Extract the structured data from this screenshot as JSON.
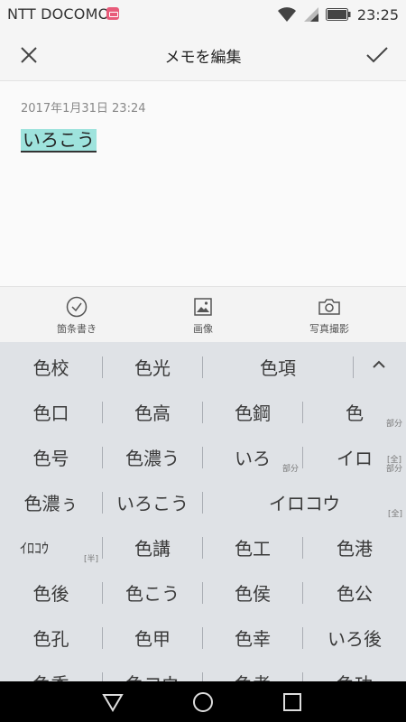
{
  "status_bar": {
    "carrier": "NTT DOCOMO",
    "time": "23:25"
  },
  "app_bar": {
    "title": "メモを編集"
  },
  "note": {
    "date": "2017年1月31日 23:24",
    "text": "いろこう"
  },
  "toolbar": {
    "items": [
      {
        "label": "箇条書き"
      },
      {
        "label": "画像"
      },
      {
        "label": "写真撮影"
      }
    ]
  },
  "candidates": {
    "rows": [
      [
        {
          "text": "色校"
        },
        {
          "text": "色光"
        },
        {
          "text": "色項"
        }
      ],
      [
        {
          "text": "色口"
        },
        {
          "text": "色高"
        },
        {
          "text": "色鋼"
        },
        {
          "text": "色",
          "badge": "部分"
        }
      ],
      [
        {
          "text": "色号"
        },
        {
          "text": "色濃う"
        },
        {
          "text": "いろ",
          "badge": "部分"
        },
        {
          "text": "イロ",
          "badge": "[全]\n部分"
        }
      ],
      [
        {
          "text": "色濃ぅ"
        },
        {
          "text": "いろこう"
        },
        {
          "text": "イロコウ",
          "badge": "[全]"
        }
      ],
      [
        {
          "text": "ｲﾛｺｳ",
          "badge": "[半]"
        },
        {
          "text": "色講"
        },
        {
          "text": "色工"
        },
        {
          "text": "色港"
        }
      ],
      [
        {
          "text": "色後"
        },
        {
          "text": "色こう"
        },
        {
          "text": "色侯"
        },
        {
          "text": "色公"
        }
      ],
      [
        {
          "text": "色孔"
        },
        {
          "text": "色甲"
        },
        {
          "text": "色幸"
        },
        {
          "text": "いろ後"
        }
      ],
      [
        {
          "text": "色香"
        },
        {
          "text": "色コウ"
        },
        {
          "text": "色考"
        },
        {
          "text": "色功"
        }
      ]
    ]
  }
}
